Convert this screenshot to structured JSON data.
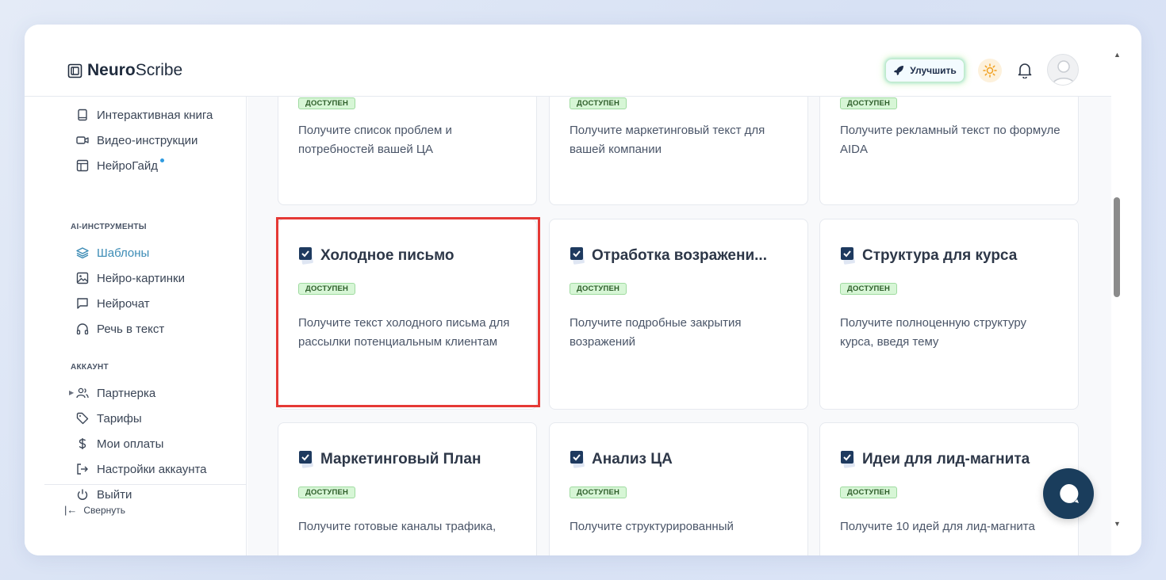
{
  "app": {
    "logo_bold": "Neuro",
    "logo_rest": "Scribe"
  },
  "header": {
    "upgrade_label": "Улучшить"
  },
  "sidebar": {
    "top_items": [
      {
        "label": "Интерактивная книга",
        "icon": "book-icon"
      },
      {
        "label": "Видео-инструкции",
        "icon": "video-icon"
      },
      {
        "label": "НейроГайд",
        "icon": "layout-icon",
        "has_dot": true
      }
    ],
    "section_tools": "AI-ИНСТРУМЕНТЫ",
    "tool_items": [
      {
        "label": "Шаблоны",
        "icon": "layers-icon",
        "active": true
      },
      {
        "label": "Нейро-картинки",
        "icon": "image-icon"
      },
      {
        "label": "Нейрочат",
        "icon": "chat-icon"
      },
      {
        "label": "Речь в текст",
        "icon": "headphones-icon"
      }
    ],
    "section_account": "АККАУНТ",
    "account_items": [
      {
        "label": "Партнерка",
        "icon": "users-icon"
      },
      {
        "label": "Тарифы",
        "icon": "tag-icon"
      },
      {
        "label": "Мои оплаты",
        "icon": "dollar-icon"
      },
      {
        "label": "Настройки аккаунта",
        "icon": "logout-arrow-icon"
      },
      {
        "label": "Выйти",
        "icon": "power-icon"
      }
    ],
    "collapse_label": "Свернуть"
  },
  "cards": [
    {
      "title": "",
      "badge": "ДОСТУПЕН",
      "desc": "Получите список проблем и потребностей вашей ЦА"
    },
    {
      "title": "",
      "badge": "ДОСТУПЕН",
      "desc": "Получите маркетинговый текст для вашей компании"
    },
    {
      "title": "",
      "badge": "ДОСТУПЕН",
      "desc": "Получите рекламный текст по формуле AIDA"
    },
    {
      "title": "Холодное письмо",
      "badge": "ДОСТУПЕН",
      "desc": "Получите текст холодного письма для рассылки потенциальным клиентам"
    },
    {
      "title": "Отработка возражени...",
      "badge": "ДОСТУПЕН",
      "desc": "Получите подробные закрытия возражений"
    },
    {
      "title": "Структура для курса",
      "badge": "ДОСТУПЕН",
      "desc": "Получите полноценную структуру курса, введя тему"
    },
    {
      "title": "Маркетинговый План",
      "badge": "ДОСТУПЕН",
      "desc": "Получите готовые каналы трафика,"
    },
    {
      "title": "Анализ ЦА",
      "badge": "ДОСТУПЕН",
      "desc": "Получите структурированный"
    },
    {
      "title": "Идеи для лид-магнита",
      "badge": "ДОСТУПЕН",
      "desc": "Получите 10 идей для лид-магнита"
    }
  ],
  "colors": {
    "accent": "#3b8bb5",
    "badge_bg": "#d7f6d6",
    "highlight": "#e53935",
    "chat": "#1a3d5c"
  }
}
